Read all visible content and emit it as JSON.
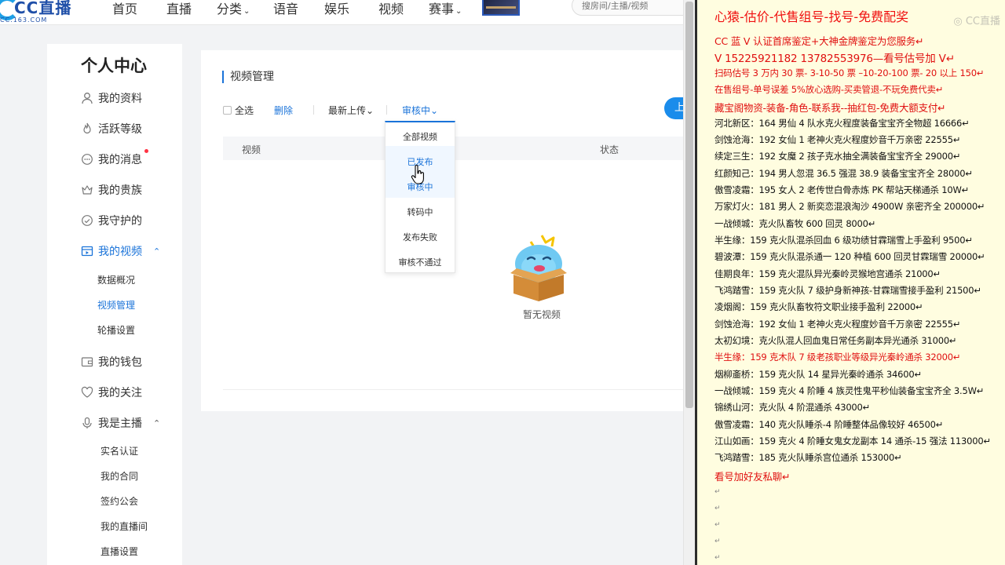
{
  "nav": {
    "logo_text": "CC直播",
    "logo_domain": "CC.163.COM",
    "items": [
      {
        "label": "首页",
        "caret": ""
      },
      {
        "label": "直播",
        "caret": ""
      },
      {
        "label": "分类",
        "caret": "⌄"
      },
      {
        "label": "语音",
        "caret": ""
      },
      {
        "label": "娱乐",
        "caret": ""
      },
      {
        "label": "视频",
        "caret": ""
      },
      {
        "label": "赛事",
        "caret": "⌄"
      }
    ],
    "search_placeholder": "搜房间/主播/视频"
  },
  "sidebar": {
    "title": "个人中心",
    "items": [
      {
        "label": "我的资料",
        "icon": "user-icon"
      },
      {
        "label": "活跃等级",
        "icon": "flame-icon"
      },
      {
        "label": "我的消息",
        "icon": "message-icon",
        "dot": true
      },
      {
        "label": "我的贵族",
        "icon": "crown-icon"
      },
      {
        "label": "我守护的",
        "icon": "guard-icon"
      },
      {
        "label": "我的视频",
        "icon": "video-icon",
        "active": true,
        "expanded": true
      },
      {
        "label": "我的钱包",
        "icon": "wallet-icon"
      },
      {
        "label": "我的关注",
        "icon": "heart-icon"
      },
      {
        "label": "我是主播",
        "icon": "mic-icon",
        "expanded": true
      }
    ],
    "video_subitems": [
      "数据概况",
      "视频管理",
      "轮播设置"
    ],
    "anchor_subitems": [
      "实名认证",
      "我的合同",
      "签约公会",
      "我的直播间",
      "直播设置"
    ],
    "expand_arrow": "⌃"
  },
  "main": {
    "title": "视频管理",
    "select_all": "全选",
    "delete": "删除",
    "sort_label": "最新上传",
    "status_label": "审核中",
    "caret": "⌄",
    "upload_label": "上",
    "table_headers": {
      "video": "视频",
      "status": "状态"
    },
    "empty_text": "暂无视频"
  },
  "dropdown": {
    "options": [
      "全部视频",
      "已发布",
      "审核中",
      "转码中",
      "发布失败",
      "审核不通过"
    ],
    "hovered_index": 1
  },
  "rightpanel": {
    "title": "心猿-估价-代售组号-找号-免费配奖",
    "watermark": "◎ CC直播",
    "lines": [
      {
        "text": "CC 蓝 V 认证首席鉴定+大神金牌鉴定为您服务↵",
        "style": "red mid"
      },
      {
        "text": "V 15225921182      13782553976—看号估号加 V↵",
        "style": "red big"
      },
      {
        "text": "扫码估号 3 万内 30 票- 3-10-50 票  –10-20-100 票- 20 以上 150↵",
        "style": "red"
      },
      {
        "text": "在售组号-单号误差 5%放心选购-买卖管退-不玩免费代卖↵",
        "style": "red"
      },
      {
        "text": "藏宝阁物资-装备-角色-联系我--抽红包-免费大额支付↵",
        "style": "red mid"
      },
      {
        "text": "河北新区：164 男仙 4 队水克火程度装备宝宝齐全物超 16666↵",
        "style": ""
      },
      {
        "text": "剑蚀沧海：192 女仙 1 老神火克火程度妙音千万亲密 22555↵",
        "style": ""
      },
      {
        "text": "续定三生：192 女魔 2 孩子克水抽全满装备宝宝齐全 29000↵",
        "style": ""
      },
      {
        "text": "红颜知己：194 男人忽混 36.5 强混 38.9 装备宝宝齐全 28000↵",
        "style": ""
      },
      {
        "text": "傲雪凌霜：195 女人 2 老传世白骨赤炼 PK 帮站天梯通杀 10W↵",
        "style": ""
      },
      {
        "text": "万家灯火：181 男人 2 新奕恋混浪淘沙 4900W 亲密齐全 200000↵",
        "style": ""
      },
      {
        "text": "一战倾城：克火队畜牧 600 回灵 8000↵",
        "style": ""
      },
      {
        "text": "半生缘：159 克火队混杀回血 6 级功绩甘霖瑞雪上手盈利 9500↵",
        "style": ""
      },
      {
        "text": "碧波潭：159 克火队混杀通一 120 种植 600 回灵甘霖瑞雪 20000↵",
        "style": ""
      },
      {
        "text": "佳期良年：159 克火混队异光秦岭灵猴地宫通杀 21000↵",
        "style": ""
      },
      {
        "text": "飞鸿踏雪：159 克火队 7 级护身新神孩-甘霖瑞雪接手盈利 21500↵",
        "style": ""
      },
      {
        "text": "凌烟阁：159 克火队畜牧符文职业接手盈利 22000↵",
        "style": ""
      },
      {
        "text": "剑蚀沧海：192 女仙 1 老神火克火程度妙音千万亲密 22555↵",
        "style": ""
      },
      {
        "text": "太初幻境：克火队混人回血鬼日常任务副本异光通杀 31000↵",
        "style": ""
      },
      {
        "text": "半生缘：159 克木队 7 级老孩职业等级异光秦岭通杀 32000↵",
        "style": "red"
      },
      {
        "text": "烟柳齑桥：159 克火队 14 星异光秦岭通杀 34600↵",
        "style": ""
      },
      {
        "text": "一战倾城：159 克火 4 阶睡 4 族灵性鬼平秒仙装备宝宝齐全 3.5W↵",
        "style": ""
      },
      {
        "text": "锦绣山河：克火队 4 阶混通杀 43000↵",
        "style": ""
      },
      {
        "text": "傲雪凌霜：140 克火队睡杀-4 阶睡整体品像较好 46500↵",
        "style": ""
      },
      {
        "text": "江山如画：159 克火 4 阶睡女鬼女龙副本 14 通杀-15 强法 113000↵",
        "style": ""
      },
      {
        "text": "飞鸿踏雪：185 克火队睡杀宫位通杀 153000↵",
        "style": ""
      },
      {
        "text": "看号加好友私聊↵",
        "style": "red mid"
      }
    ],
    "pilcrow": "↵"
  }
}
